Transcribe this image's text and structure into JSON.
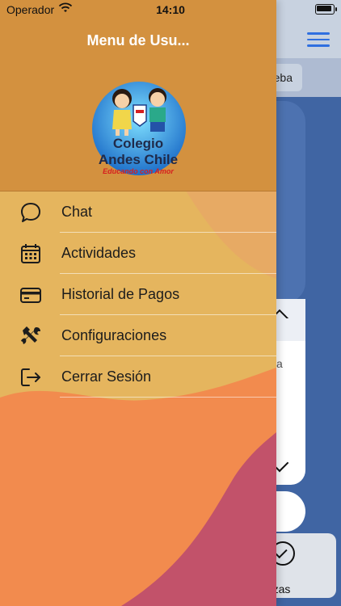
{
  "status_bar": {
    "carrier": "Operador",
    "time": "14:10"
  },
  "background_app": {
    "chip_text": "eba",
    "field_letter": "a",
    "tab_label": "anzas"
  },
  "drawer": {
    "title": "Menu de Usu...",
    "logo": {
      "line1": "Colegio",
      "line2": "Andes Chile",
      "tagline": "Educando con Amor",
      "badge": "ANDES CHILE"
    },
    "items": [
      {
        "label": "Chat",
        "icon": "chat-bubble-icon"
      },
      {
        "label": "Actividades",
        "icon": "calendar-icon"
      },
      {
        "label": "Historial de Pagos",
        "icon": "credit-card-icon"
      },
      {
        "label": "Configuraciones",
        "icon": "tools-icon"
      },
      {
        "label": "Cerrar Sesión",
        "icon": "logout-icon"
      }
    ]
  },
  "colors": {
    "drawer_header": "#d3913f",
    "drawer_menu": "#e5b55e",
    "wave_orange": "#f28b4e",
    "wave_rose": "#c2526a",
    "background_app": "#4065a3",
    "hamburger": "#2f6fe0"
  }
}
